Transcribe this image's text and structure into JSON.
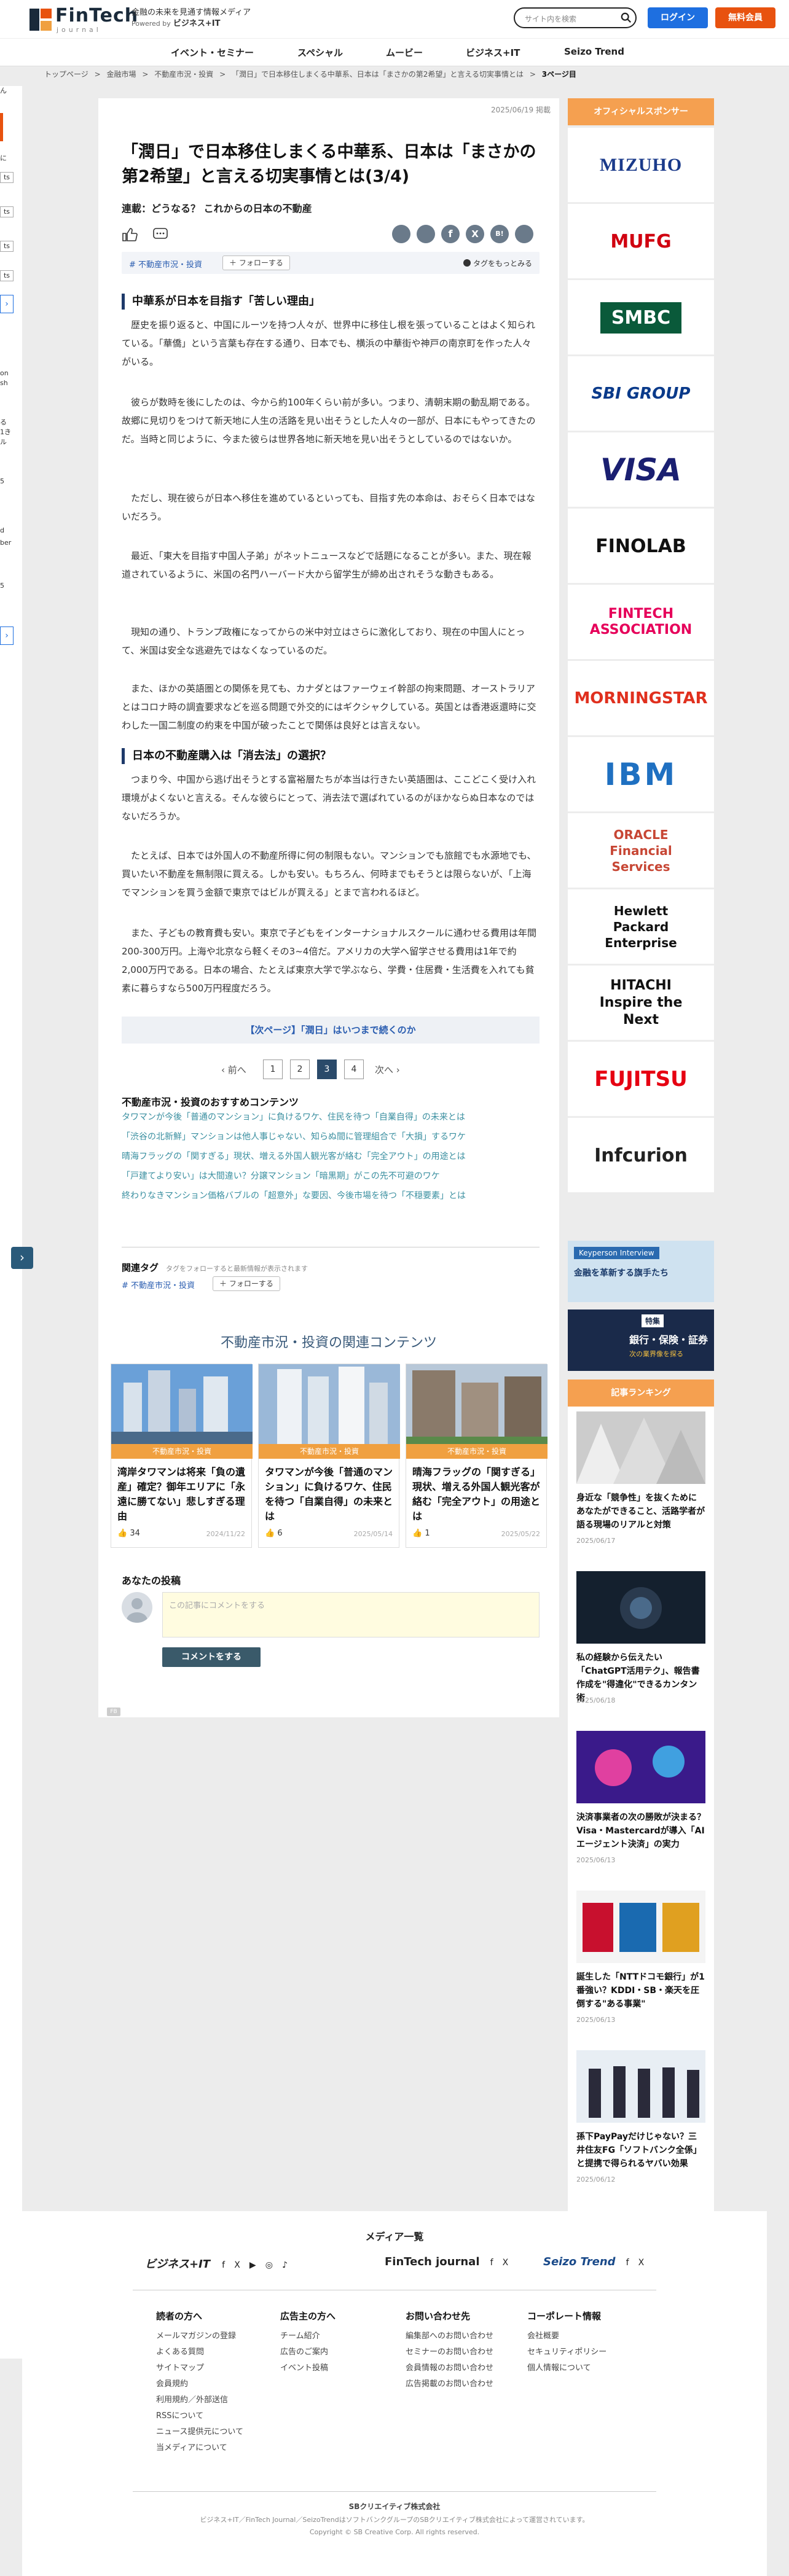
{
  "header": {
    "logo_text": "FinTech",
    "logo_sub": "journal",
    "tagline_1": "金融の未来を見通す情報メディア",
    "tagline_2_prefix": "Powered by",
    "tagline_2_brand": "ビジネス+IT",
    "search_placeholder": "サイト内を検索",
    "login_label": "ログイン",
    "register_label": "無料会員",
    "nav": [
      "イベント・セミナー",
      "スペシャル",
      "ムービー",
      "ビジネス+IT",
      "Seizo Trend"
    ]
  },
  "breadcrumb": [
    "トップページ",
    ">",
    "金融市場",
    ">",
    "不動産市況・投資",
    ">",
    "「潤日」で日本移住しまくる中華系、日本は「まさかの第2希望」と言える切実事情とは",
    ">",
    "3ページ目"
  ],
  "left_peek": [
    "ん",
    "に",
    "ts",
    "ts",
    "ts",
    "ts",
    "on",
    "sh",
    "る",
    "1き",
    "ル",
    "5",
    "d",
    "ber",
    "5"
  ],
  "article": {
    "date": "2025/06/19 掲載",
    "title": "「潤日」で日本移住しまくる中華系、日本は「まさかの第2希望」と言える切実事情とは(3/4)",
    "series": "連載：どうなる？ これからの日本の不動産",
    "tag": "# 不動産市況・投資",
    "follow_label": "＋ フォローする",
    "tag_more": "タグをもっとみる",
    "h2_1": "中華系が日本を目指す「苦しい理由」",
    "p1": "歴史を振り返ると、中国にルーツを持つ人々が、世界中に移住し根を張っていることはよく知られている。「華僑」という言葉も存在する通り、日本でも、横浜の中華街や神戸の南京町を作った人々がいる。",
    "p2": "彼らが数時を後にしたのは、今から約100年くらい前が多い。つまり、清朝末期の動乱期である。故郷に見切りをつけて新天地に人生の活路を見い出そうとした人々の一部が、日本にもやってきたのだ。当時と同じように、今また彼らは世界各地に新天地を見い出そうとしているのではないか。",
    "p3": "ただし、現在彼らが日本へ移住を進めているといっても、目指す先の本命は、おそらく日本ではないだろう。",
    "p4": "最近、「東大を目指す中国人子弟」がネットニュースなどで話題になることが多い。また、現在報道されているように、米国の名門ハーバード大から留学生が締め出されそうな動きもある。",
    "p5": "現知の通り、トランプ政権になってからの米中対立はさらに激化しており、現在の中国人にとって、米国は安全な逃避先ではなくなっているのだ。",
    "p6": "また、ほかの英語圏との関係を見ても、カナダとはファーウェイ幹部の拘束問題、オーストラリアとはコロナ時の調査要求などを巡る問題で外交的にはギクシャクしている。英国とは香港返還時に交わした一国二制度の約束を中国が破ったことで関係は良好とは言えない。",
    "h2_2": "日本の不動産購入は「消去法」の選択？",
    "p7": "つまり今、中国から逃げ出そうとする富裕層たちが本当は行きたい英語圏は、ここどこく受け入れ環境がよくないと言える。そんな彼らにとって、消去法で選ばれているのがほかならぬ日本なのではないだろうか。",
    "p8": "たとえば、日本では外国人の不動産所得に何の制限もない。マンションでも旅館でも水源地でも、買いたい不動産を無制限に買える。しかも安い。もちろん、何時までもそうとは限らないが、「上海でマンションを買う金額で東京ではビルが買える」とまで言われるほど。",
    "p9": "また、子どもの教育費も安い。東京で子どもをインターナショナルスクールに通わせる費用は年間200-300万円。上海や北京なら軽くその3~4倍だ。アメリカの大学へ留学させる費用は1年で約2,000万円である。日本の場合、たとえば東京大学で学ぶなら、学費・住居費・生活費を入れても貧素に暮らすなら500万円程度だろう。",
    "next_page": "【次ページ】「潤日」はいつまで続くのか",
    "pager_prev": "前へ",
    "pager_pages": [
      "1",
      "2",
      "3",
      "4"
    ],
    "pager_current": "3",
    "pager_next": "次へ",
    "rec_heading": "不動産市況・投資のおすすめコンテンツ",
    "rec_items": [
      "タワマンが今後「普通のマンション」に負けるワケ、住民を待つ「自業自得」の未来とは",
      "「渋谷の北新鮮」マンションは他人事じゃない、知らぬ間に管理組合で「大損」するワケ",
      "晴海フラッグの「関すぎる」現状、増える外国人観光客が絡む「完全アウト」の用途とは",
      "「戸建てより安い」は大間違い？分譲マンション「暗黒期」がこの先不可避のワケ",
      "終わりなきマンション価格バブルの「超意外」な要因、今後市場を待つ「不穏要素」とは"
    ],
    "reltag_heading": "関連タグ",
    "reltag_sub": "タグをフォローすると最新情報が表示されます",
    "reltag": "# 不動産市況・投資",
    "related_heading": "不動産市況・投資の関連コンテンツ",
    "cards": [
      {
        "cat": "不動産市況・投資",
        "title": "湾岸タワマンは将来「負の遺産」確定？御年エリアに「永遠に勝てない」悲しすぎる理由",
        "likes": "34",
        "date": "2024/11/22"
      },
      {
        "cat": "不動産市況・投資",
        "title": "タワマンが今後「普通のマンション」に負けるワケ、住民を待つ「自業自得」の未来とは",
        "likes": "6",
        "date": "2025/05/14"
      },
      {
        "cat": "不動産市況・投資",
        "title": "晴海フラッグの「関すぎる」現状、増える外国人観光客が絡む「完全アウト」の用途とは",
        "likes": "1",
        "date": "2025/05/22"
      }
    ],
    "post_heading": "あなたの投稿",
    "comment_placeholder": "この記事にコメントをする",
    "comment_submit": "コメントをする",
    "fb_mini": "FB"
  },
  "sidebar": {
    "sponsor_head": "オフィシャルスポンサー",
    "sponsors": [
      "MIZUHO",
      "MUFG",
      "SMBC",
      "SBI GROUP",
      "VISA",
      "FINOLAB",
      "FINTECH ASSOCIATION",
      "MORNINGSTAR",
      "IBM",
      "ORACLE Financial Services",
      "Hewlett Packard Enterprise",
      "HITACHI Inspire the Next",
      "FUJITSU",
      "Infcurion"
    ],
    "banner1_title": "Keyperson Interview",
    "banner1_sub": "金融を革新する旗手たち",
    "banner2_title": "特集",
    "banner2_sub": "銀行・保険・証券",
    "banner2_note": "次の業界像を探る",
    "ranking_head": "記事ランキング",
    "ranking": [
      {
        "title": "身近な「競争性」を抜くために あなたができること、活路学者が語る現場のリアルと対策",
        "date": "2025/06/17"
      },
      {
        "title": "私の経験から伝えたい「ChatGPT活用テク」、報告書作成を\"得違化\"できるカンタン術",
        "date": "2025/06/18"
      },
      {
        "title": "決済事業者の次の勝敗が決まる？Visa・Mastercardが導入「AIエージェント決済」の実力",
        "date": "2025/06/13"
      },
      {
        "title": "誕生した「NTTドコモ銀行」が1番強い？KDDI・SB・楽天を圧倒する\"ある事業\"",
        "date": "2025/06/13"
      },
      {
        "title": "孫下PayPayだけじゃない？三井住友FG「ソフトバンク全係」と提携で得られるヤバい効果",
        "date": "2025/06/12"
      }
    ]
  },
  "footer": {
    "media_heading": "メディア一覧",
    "brands": [
      "ビジネス+IT",
      "FinTech journal",
      "Seizo Trend"
    ],
    "col1_head": "読者の方へ",
    "col1": [
      "メールマガジンの登録",
      "よくある質問",
      "サイトマップ",
      "会員規約",
      "利用規約／外部送信",
      "RSSについて",
      "ニュース提供元について",
      "当メディアについて"
    ],
    "col2_head": "広告主の方へ",
    "col2": [
      "チーム紹介",
      "広告のご案内",
      "イベント投稿"
    ],
    "col3_head": "お問い合わせ先",
    "col3": [
      "編集部へのお問い合わせ",
      "セミナーのお問い合わせ",
      "会員情報のお問い合わせ",
      "広告掲載のお問い合わせ"
    ],
    "col4_head": "コーポレート情報",
    "col4": [
      "会社概要",
      "セキュリティポリシー",
      "個人情報について"
    ],
    "company": "SBクリエイティブ株式会社",
    "note": "ビジネス+IT／FinTech Journal／SeizoTrendはソフトバンクグループのSBクリエイティブ株式会社によって運営されています。",
    "copyright": "Copyright © SB Creative Corp. All rights reserved."
  },
  "colors": {
    "accent": "#1e6fe0",
    "register": "#e8520f",
    "link": "#3a8fa0",
    "sidebar_head": "#f5a050"
  }
}
